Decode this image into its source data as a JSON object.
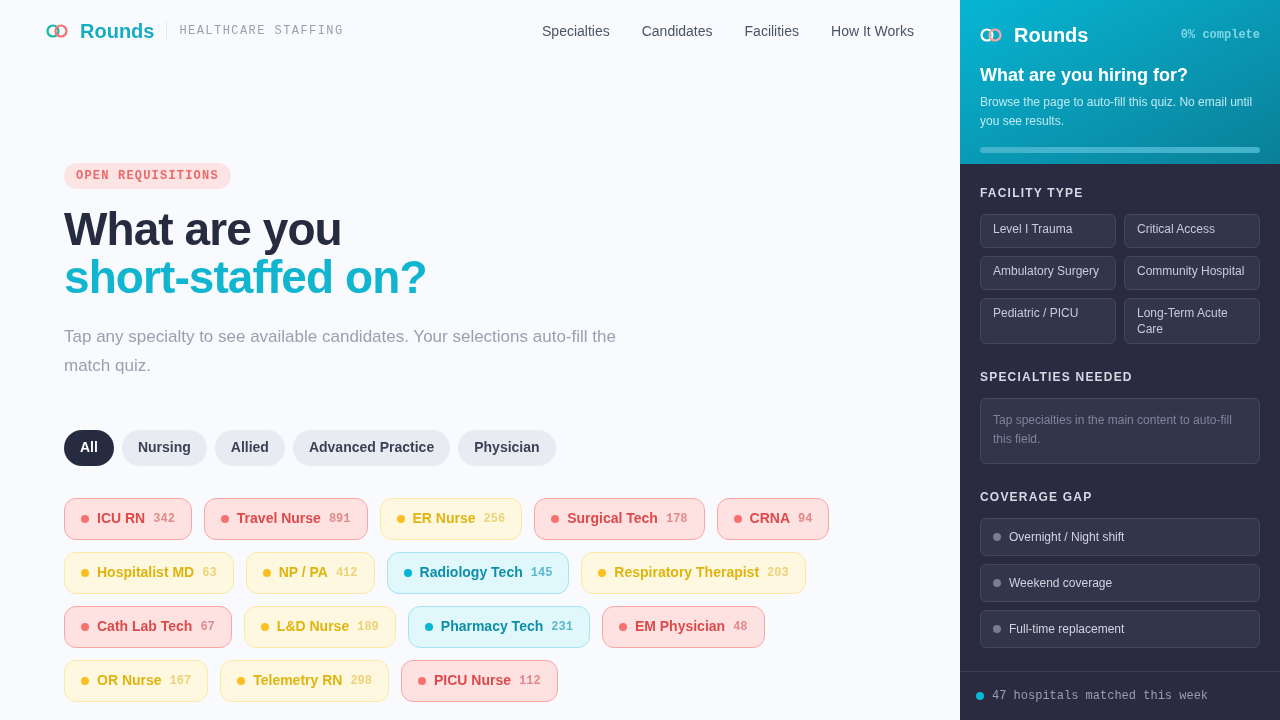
{
  "header": {
    "brand": "Rounds",
    "tagline": "HEALTHCARE STAFFING",
    "nav": [
      "Specialties",
      "Candidates",
      "Facilities",
      "How It Works"
    ]
  },
  "hero": {
    "badge": "OPEN REQUISITIONS",
    "title_line1": "What are you",
    "title_line2": "short-staffed on?",
    "subtitle": "Tap any specialty to see available candidates. Your selections auto-fill the match quiz."
  },
  "filters": [
    {
      "label": "All",
      "selected": true
    },
    {
      "label": "Nursing",
      "selected": false
    },
    {
      "label": "Allied",
      "selected": false
    },
    {
      "label": "Advanced Practice",
      "selected": false
    },
    {
      "label": "Physician",
      "selected": false
    }
  ],
  "specialties": [
    {
      "name": "ICU RN",
      "count": "342",
      "color": "#f87171"
    },
    {
      "name": "Travel Nurse",
      "count": "891",
      "color": "#f87171"
    },
    {
      "name": "ER Nurse",
      "count": "256",
      "color": "#fbbf24"
    },
    {
      "name": "Surgical Tech",
      "count": "178",
      "color": "#f87171"
    },
    {
      "name": "CRNA",
      "count": "94",
      "color": "#f87171"
    },
    {
      "name": "Hospitalist MD",
      "count": "63",
      "color": "#fbbf24"
    },
    {
      "name": "NP / PA",
      "count": "412",
      "color": "#fbbf24"
    },
    {
      "name": "Radiology Tech",
      "count": "145",
      "color": "#06b6d4"
    },
    {
      "name": "Respiratory Therapist",
      "count": "203",
      "color": "#fbbf24"
    },
    {
      "name": "Cath Lab Tech",
      "count": "67",
      "color": "#f87171"
    },
    {
      "name": "L&D Nurse",
      "count": "189",
      "color": "#fbbf24"
    },
    {
      "name": "Pharmacy Tech",
      "count": "231",
      "color": "#06b6d4"
    },
    {
      "name": "EM Physician",
      "count": "48",
      "color": "#f87171"
    },
    {
      "name": "OR Nurse",
      "count": "167",
      "color": "#fbbf24"
    },
    {
      "name": "Telemetry RN",
      "count": "298",
      "color": "#fbbf24"
    },
    {
      "name": "PICU Nurse",
      "count": "112",
      "color": "#f87171"
    }
  ],
  "quiz": {
    "brand": "Rounds",
    "progress_text": "0% complete",
    "title": "What are you hiring for?",
    "subtitle": "Browse the page to auto-fill this quiz. No email until you see results.",
    "progress": {
      "level": 0
    },
    "facility_heading": "FACILITY TYPE",
    "facility_types": [
      {
        "label": "Level I Trauma",
        "selected": false
      },
      {
        "label": "Critical Access",
        "selected": false
      },
      {
        "label": "Ambulatory Surgery",
        "selected": false
      },
      {
        "label": "Community Hospital",
        "selected": false
      },
      {
        "label": "Pediatric / PICU",
        "selected": false
      },
      {
        "label": "Long-Term Acute Care",
        "selected": false
      }
    ],
    "specialties_heading": "SPECIALTIES NEEDED",
    "specialties_placeholder": "Tap specialties in the main content to auto-fill this field.",
    "coverage_heading": "COVERAGE GAP",
    "coverage": [
      {
        "label": "Overnight / Night shift",
        "checked": false
      },
      {
        "label": "Weekend coverage",
        "checked": false
      },
      {
        "label": "Full-time replacement",
        "checked": false
      }
    ],
    "footer": "47 hospitals matched this week"
  }
}
